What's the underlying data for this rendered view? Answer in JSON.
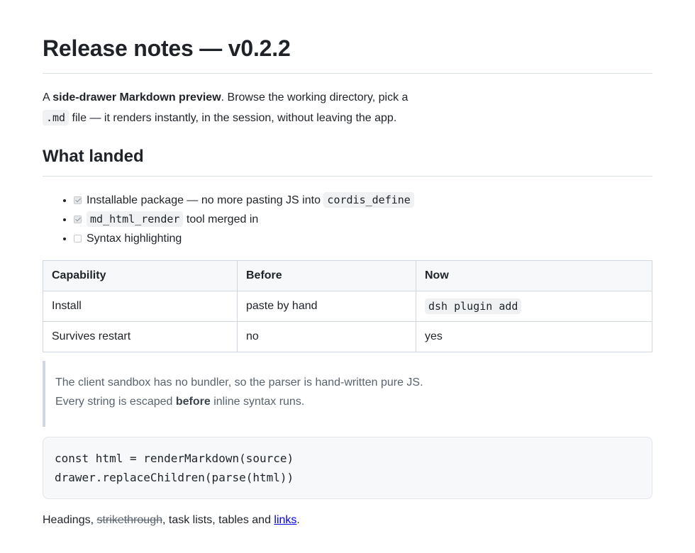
{
  "title": "Release notes — v0.2.2",
  "intro": {
    "prefix": "A ",
    "bold": "side-drawer Markdown preview",
    "middle": ". Browse the working directory, pick a",
    "code": ".md",
    "suffix": " file — it renders instantly, in the session, without leaving the app."
  },
  "section_heading": "What landed",
  "tasks": [
    {
      "checked": true,
      "text_before": "Installable package — no more pasting JS into ",
      "code": "cordis_define",
      "text_after": ""
    },
    {
      "checked": true,
      "text_before": "",
      "code": "md_html_render",
      "text_after": " tool merged in"
    },
    {
      "checked": false,
      "text_before": "Syntax highlighting",
      "code": "",
      "text_after": ""
    }
  ],
  "table": {
    "headers": [
      "Capability",
      "Before",
      "Now"
    ],
    "rows": [
      [
        "Install",
        "paste by hand",
        "dsh plugin add"
      ],
      [
        "Survives restart",
        "no",
        "yes"
      ]
    ]
  },
  "quote": {
    "line1": "The client sandbox has no bundler, so the parser is hand-written pure JS.",
    "line2_prefix": "Every string is escaped ",
    "line2_bold": "before",
    "line2_suffix": " inline syntax runs."
  },
  "code_block": [
    "const html = renderMarkdown(source)",
    "drawer.replaceChildren(parse(html))"
  ],
  "footer": {
    "prefix": "Headings, ",
    "strike": "strikethrough",
    "middle": ", task lists, tables and ",
    "link": "links",
    "suffix": "."
  }
}
